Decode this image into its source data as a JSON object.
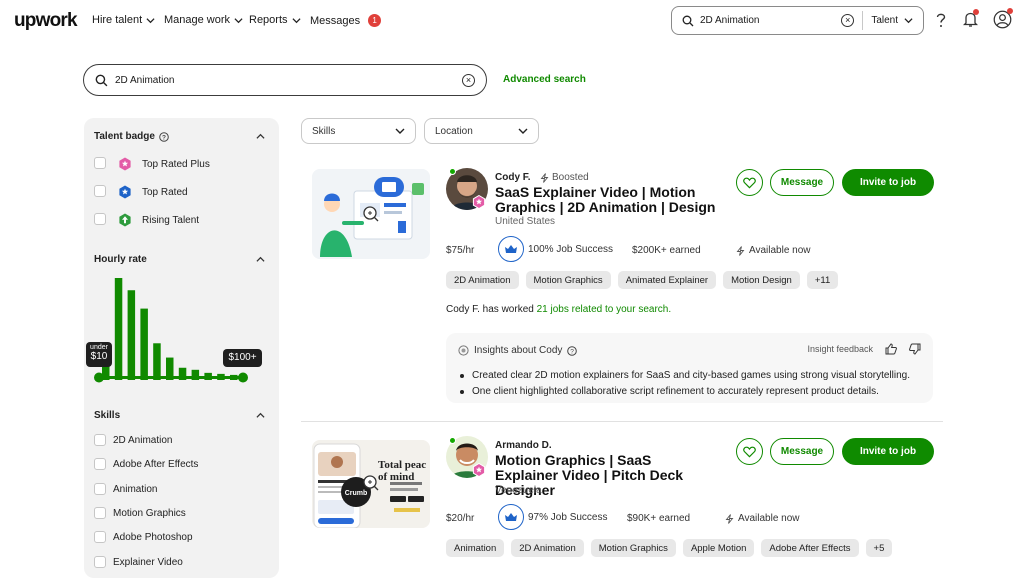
{
  "nav": {
    "logo": "upwork",
    "items": [
      "Hire talent",
      "Manage work",
      "Reports",
      "Messages"
    ],
    "messages_count": "1"
  },
  "top_search": {
    "value": "2D Animation",
    "scope": "Talent"
  },
  "main_search": {
    "value": "2D Animation",
    "advanced_label": "Advanced search"
  },
  "sidebar": {
    "talent_badge": {
      "title": "Talent badge",
      "options": [
        "Top Rated Plus",
        "Top Rated",
        "Rising Talent"
      ]
    },
    "hourly_rate": {
      "title": "Hourly rate",
      "min_top": "under",
      "min_label": "$10",
      "max_label": "$100+",
      "histogram": [
        16,
        100,
        88,
        70,
        36,
        22,
        12,
        10,
        7,
        6,
        5
      ]
    },
    "skills": {
      "title": "Skills",
      "options": [
        "2D Animation",
        "Adobe After Effects",
        "Animation",
        "Motion Graphics",
        "Adobe Photoshop",
        "Explainer Video"
      ]
    }
  },
  "filters": {
    "skills": "Skills",
    "location": "Location"
  },
  "cards": [
    {
      "name": "Cody F.",
      "boosted": "Boosted",
      "title": "SaaS Explainer Video | Motion Graphics | 2D Animation | Design",
      "country": "United States",
      "rate": "$75/hr",
      "job_success": "100% Job Success",
      "earned": "$200K+ earned",
      "availability": "Available now",
      "tags": [
        "2D Animation",
        "Motion Graphics",
        "Animated Explainer",
        "Motion Design",
        "+11"
      ],
      "worked_prefix": "Cody F. has worked",
      "worked_link": "21 jobs related to your search.",
      "message_label": "Message",
      "invite_label": "Invite to job"
    },
    {
      "name": "Armando D.",
      "title": "Motion Graphics | SaaS Explainer Video | Pitch Deck Designer",
      "country": "Venezuela",
      "rate": "$20/hr",
      "job_success": "97% Job Success",
      "earned": "$90K+ earned",
      "availability": "Available now",
      "tags": [
        "Animation",
        "2D Animation",
        "Motion Graphics",
        "Apple Motion",
        "Adobe After Effects",
        "+5"
      ],
      "message_label": "Message",
      "invite_label": "Invite to job",
      "thumb_text": "Total peac of mind",
      "thumb_logo": "Crumb"
    }
  ],
  "insights": {
    "title": "Insights about Cody",
    "feedback_label": "Insight feedback",
    "bullets": [
      "Created clear 2D motion explainers for SaaS and city-based games using strong visual storytelling.",
      "One client highlighted collaborative script refinement to accurately represent product details."
    ]
  },
  "colors": {
    "brand_green": "#108a00",
    "badge_red": "#e0403a",
    "job_success_blue": "#1e63c8"
  }
}
